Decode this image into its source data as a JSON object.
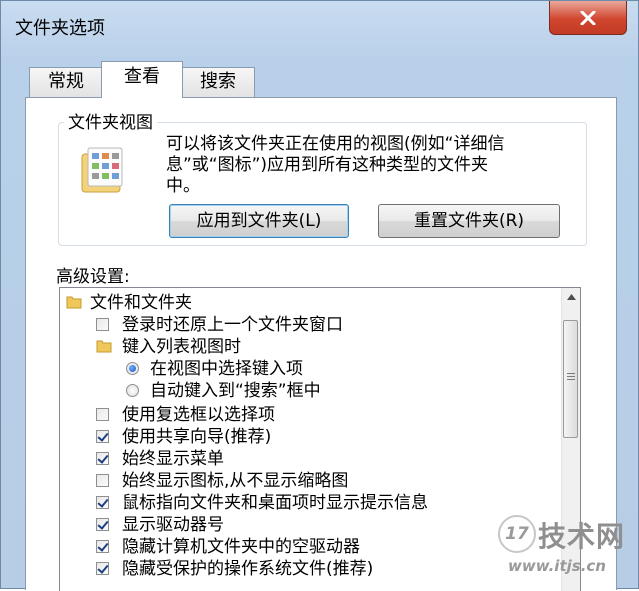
{
  "window": {
    "title": "文件夹选项"
  },
  "tabs": [
    {
      "label": "常规"
    },
    {
      "label": "查看"
    },
    {
      "label": "搜索"
    }
  ],
  "folder_views": {
    "group_title": "文件夹视图",
    "description_line1": "可以将该文件夹正在使用的视图(例如“详细信",
    "description_line2": "息”或“图标”)应用到所有这种类型的文件夹",
    "description_line3": "中。",
    "apply_button": "应用到文件夹(L)",
    "reset_button": "重置文件夹(R)"
  },
  "advanced": {
    "label": "高级设置:",
    "items": [
      {
        "type": "folder",
        "label": "文件和文件夹"
      },
      {
        "type": "checkbox",
        "checked": false,
        "label": "登录时还原上一个文件夹窗口"
      },
      {
        "type": "folder",
        "label": "键入列表视图时"
      },
      {
        "type": "radio",
        "checked": true,
        "label": "在视图中选择键入项"
      },
      {
        "type": "radio",
        "checked": false,
        "label": "自动键入到“搜索”框中"
      },
      {
        "type": "checkbox",
        "checked": false,
        "label": "使用复选框以选择项"
      },
      {
        "type": "checkbox",
        "checked": true,
        "label": "使用共享向导(推荐)"
      },
      {
        "type": "checkbox",
        "checked": true,
        "label": "始终显示菜单"
      },
      {
        "type": "checkbox",
        "checked": false,
        "label": "始终显示图标,从不显示缩略图"
      },
      {
        "type": "checkbox",
        "checked": true,
        "label": "鼠标指向文件夹和桌面项时显示提示信息"
      },
      {
        "type": "checkbox",
        "checked": true,
        "label": "显示驱动器号"
      },
      {
        "type": "checkbox",
        "checked": true,
        "label": "隐藏计算机文件夹中的空驱动器"
      },
      {
        "type": "checkbox",
        "checked": true,
        "label": "隐藏受保护的操作系统文件(推荐)"
      }
    ]
  },
  "watermark": {
    "logo_text": "17",
    "name": "技术网",
    "url": "www.itjs.cn"
  },
  "colors": {
    "close_button": "#c94a33",
    "accent": "#1a55c4"
  }
}
